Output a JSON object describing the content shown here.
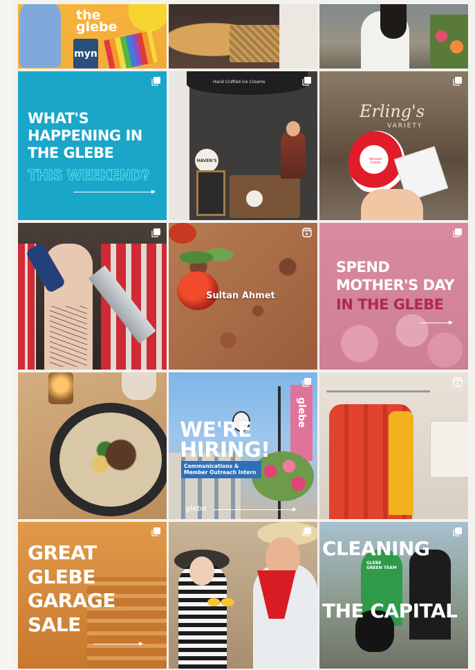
{
  "feed": {
    "tiles": [
      {
        "id": "t1",
        "label": "the glebe",
        "subtitle": "",
        "kind": "logo",
        "badge": "none"
      },
      {
        "id": "t2",
        "label": "",
        "kind": "photo",
        "badge": "none"
      },
      {
        "id": "t3",
        "label": "",
        "kind": "photo",
        "badge": "none"
      },
      {
        "id": "t4",
        "label": "WHAT'S HAPPENING IN THE GLEBE",
        "accent": "THIS WEEKEND?",
        "kind": "graphic",
        "badge": "carousel"
      },
      {
        "id": "t5",
        "label": "HAVEN'S",
        "sign": "Hand Crafted Ice Creams",
        "kind": "photo",
        "badge": "carousel"
      },
      {
        "id": "t6",
        "label": "Erling's",
        "sign": "VARIETY",
        "ball": "Volleyball Canada",
        "kind": "photo",
        "badge": "carousel"
      },
      {
        "id": "t7",
        "label": "",
        "kind": "photo",
        "badge": "carousel"
      },
      {
        "id": "t8",
        "label": "Sultan Ahmet",
        "kind": "photo",
        "badge": "reel"
      },
      {
        "id": "t9",
        "label": "SPEND MOTHER'S DAY",
        "accent": "IN THE GLEBE",
        "kind": "graphic",
        "badge": "carousel"
      },
      {
        "id": "t10",
        "label": "",
        "kind": "photo",
        "badge": "none"
      },
      {
        "id": "t11",
        "label": "WE'RE HIRING!",
        "sub": "Communications & Member Outreach Intern",
        "brand": "glebe",
        "banner": "glebe",
        "kind": "graphic",
        "badge": "carousel"
      },
      {
        "id": "t12",
        "label": "",
        "kind": "photo",
        "badge": "reel"
      },
      {
        "id": "t13",
        "label": "GREAT GLEBE GARAGE SALE",
        "kind": "graphic",
        "badge": "carousel"
      },
      {
        "id": "t14",
        "label": "",
        "kind": "photo",
        "badge": "carousel"
      },
      {
        "id": "t15",
        "label": "CLEANING THE CAPITAL",
        "shirt": "GLEBE GREEN TEAM",
        "kind": "graphic",
        "badge": "carousel"
      }
    ]
  },
  "colors": {
    "page_bg": "#f4f2ee",
    "teal": "#1aa6c8",
    "teal_accent": "#2bd3ea",
    "mothers_pink": "#d98da3",
    "mothers_accent": "#b0294f",
    "hiring_blue": "#5d9fd8",
    "garage_orange": "#d88a3c"
  },
  "icons": {
    "carousel": "carousel-icon",
    "reel": "reel-icon"
  }
}
